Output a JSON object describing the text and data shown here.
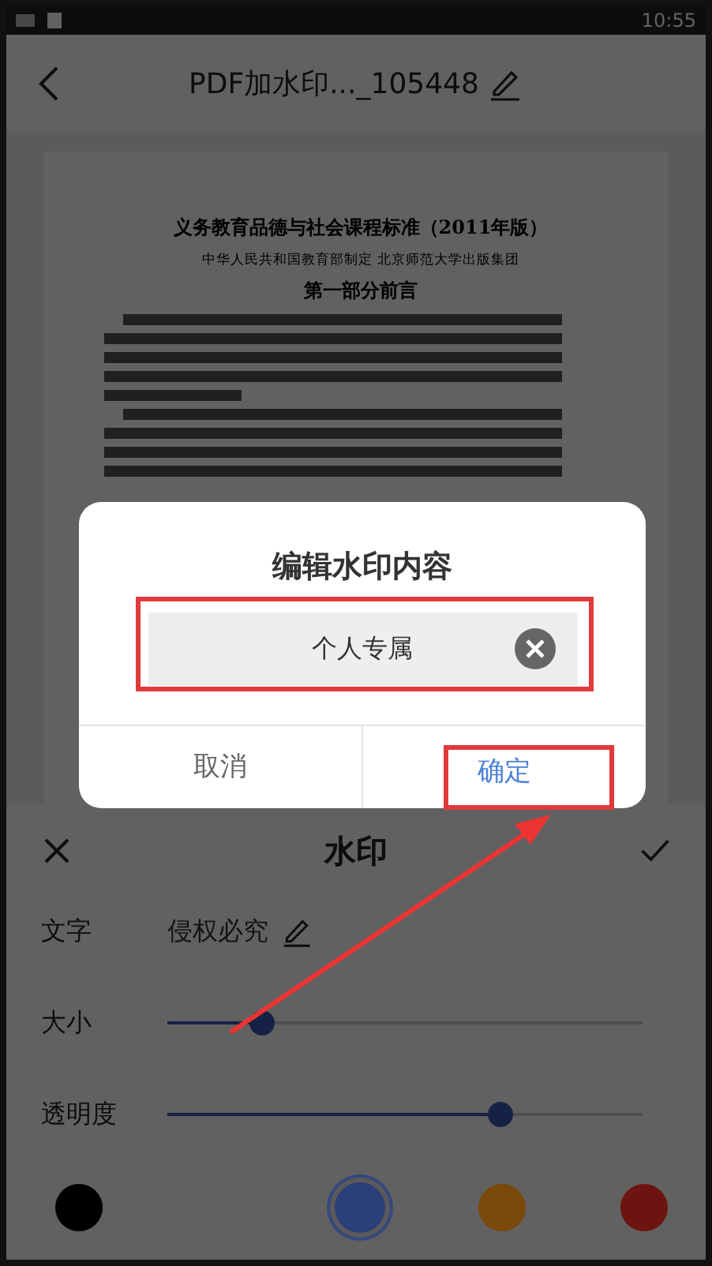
{
  "status_bar": {
    "time": "10:55"
  },
  "header": {
    "title": "PDF加水印..._105448"
  },
  "document": {
    "title": "义务教育品德与社会课程标准（2011年版）",
    "subtitle": "中华人民共和国教育部制定 北京师范大学出版集团",
    "heading": "第一部分前言"
  },
  "watermark_panel": {
    "title": "水印",
    "text_row": {
      "label": "文字",
      "value": "侵权必究"
    },
    "sliders": [
      {
        "label": "大小",
        "level": 0.2
      },
      {
        "label": "透明度",
        "level": 0.7
      }
    ],
    "colors": [
      {
        "color": "#000000",
        "selected": false
      },
      {
        "color": "#2b3f78",
        "selected": true
      },
      {
        "color": "#7a4808",
        "selected": false
      },
      {
        "color": "#6e1410",
        "selected": false
      }
    ]
  },
  "dialog": {
    "title": "编辑水印内容",
    "input_value": "个人专属",
    "buttons": [
      {
        "label": "取消",
        "kind": "cancel"
      },
      {
        "label": "确定",
        "kind": "confirm"
      }
    ]
  }
}
